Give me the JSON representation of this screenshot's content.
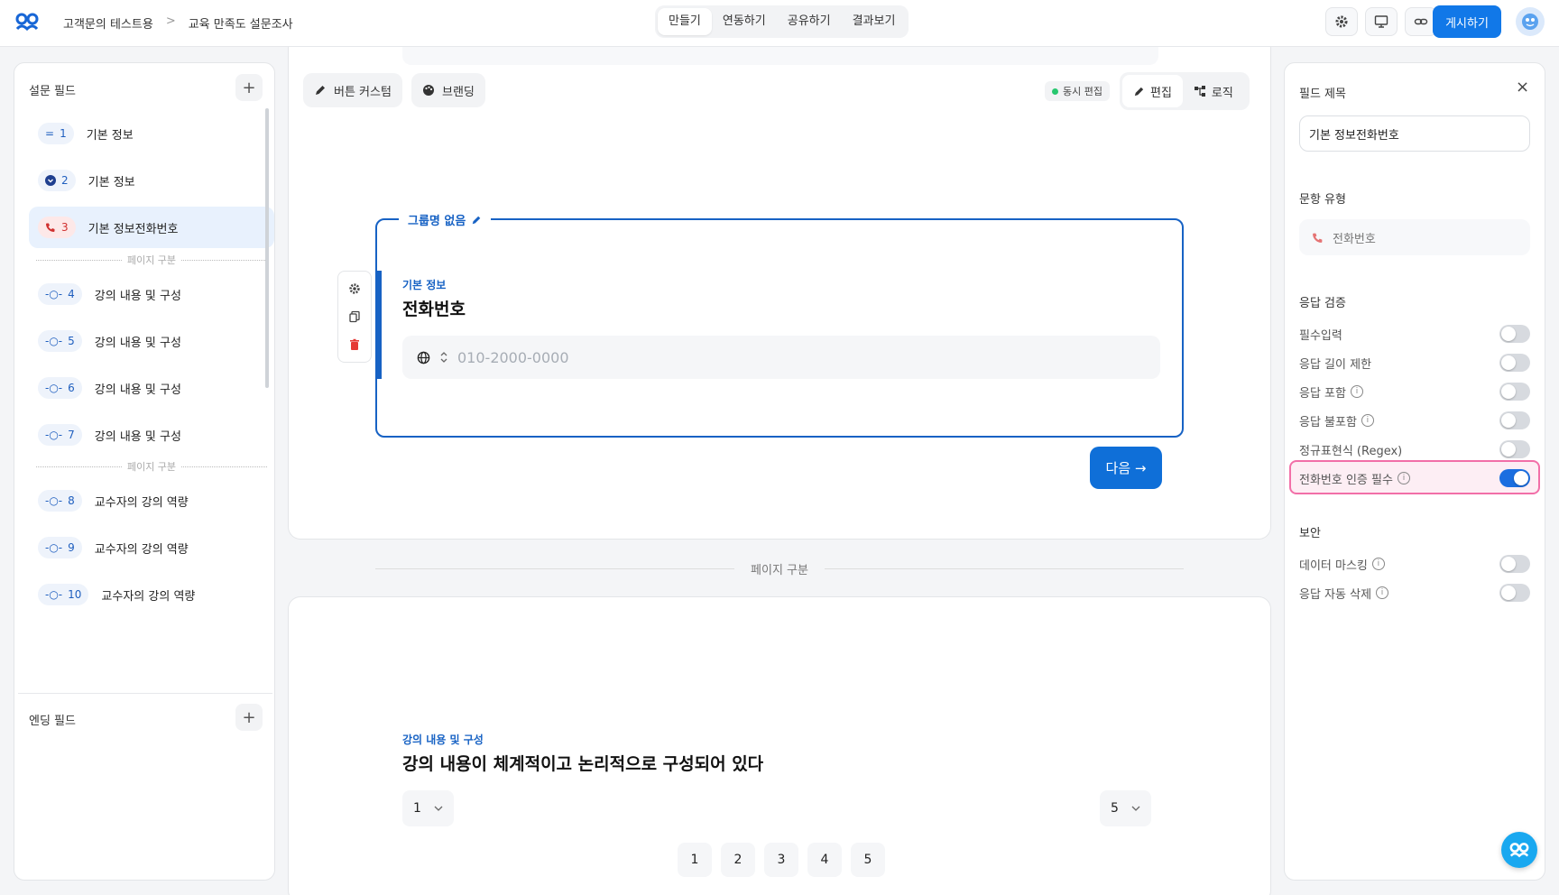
{
  "header": {
    "breadcrumb": [
      "고객문의 테스트용",
      "교육 만족도 설문조사"
    ],
    "breadcrumb_sep": ">",
    "tabs": [
      "만들기",
      "연동하기",
      "공유하기",
      "결과보기"
    ],
    "active_tab": "만들기",
    "publish_label": "게시하기"
  },
  "left_panel": {
    "survey_fields_title": "설문 필드",
    "ending_fields_title": "엔딩 필드",
    "page_break_label": "페이지 구분",
    "items": [
      {
        "num": "1",
        "icon": "text-lines-icon",
        "label": "기본 정보"
      },
      {
        "num": "2",
        "icon": "dropdown-circle-icon",
        "label": "기본 정보"
      },
      {
        "num": "3",
        "icon": "phone-icon",
        "label": "기본 정보전화번호"
      },
      {
        "num": "4",
        "icon": "scale-slider-icon",
        "label": "강의 내용 및 구성"
      },
      {
        "num": "5",
        "icon": "scale-slider-icon",
        "label": "강의 내용 및 구성"
      },
      {
        "num": "6",
        "icon": "scale-slider-icon",
        "label": "강의 내용 및 구성"
      },
      {
        "num": "7",
        "icon": "scale-slider-icon",
        "label": "강의 내용 및 구성"
      },
      {
        "num": "8",
        "icon": "scale-slider-icon",
        "label": "교수자의 강의 역량"
      },
      {
        "num": "9",
        "icon": "scale-slider-icon",
        "label": "교수자의 강의 역량"
      },
      {
        "num": "10",
        "icon": "scale-slider-icon",
        "label": "교수자의 강의 역량"
      }
    ]
  },
  "toolbar": {
    "button_custom": "버튼 커스텀",
    "branding": "브랜딩",
    "live_edit": "동시 편집",
    "edit": "편집",
    "logic": "로직"
  },
  "question1": {
    "group_title": "그룹명 없음",
    "category": "기본 정보",
    "title": "전화번호",
    "placeholder": "010-2000-0000",
    "next_label": "다음 →"
  },
  "page_break": "페이지 구분",
  "question2": {
    "category": "강의 내용 및 구성",
    "title": "강의 내용이 체계적이고 논리적으로 구성되어 있다",
    "min_value": "1",
    "max_value": "5",
    "scale": [
      "1",
      "2",
      "3",
      "4",
      "5"
    ]
  },
  "right_panel": {
    "field_title_label": "필드 제목",
    "field_title_value": "기본 정보전화번호",
    "question_type_label": "문항 유형",
    "question_type_value": "전화번호",
    "validation_label": "응답 검증",
    "validation": [
      {
        "label": "필수입력",
        "info": false,
        "on": false
      },
      {
        "label": "응답 길이 제한",
        "info": false,
        "on": false
      },
      {
        "label": "응답 포함",
        "info": true,
        "on": false
      },
      {
        "label": "응답 불포함",
        "info": true,
        "on": false
      },
      {
        "label": "정규표현식 (Regex)",
        "info": false,
        "on": false
      },
      {
        "label": "전화번호 인증 필수",
        "info": true,
        "on": true
      }
    ],
    "security_label": "보안",
    "security": [
      {
        "label": "데이터 마스킹",
        "info": true,
        "on": false
      },
      {
        "label": "응답 자동 삭제",
        "info": true,
        "on": false
      }
    ]
  },
  "colors": {
    "accent": "#1178e8",
    "highlight_border": "#f26fa8",
    "phone_red": "#d0302f"
  }
}
